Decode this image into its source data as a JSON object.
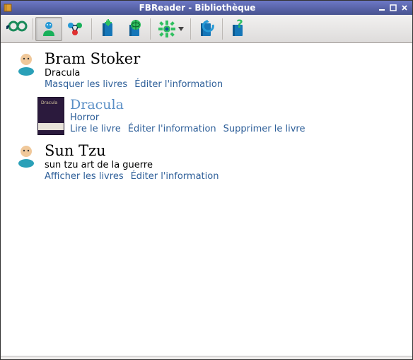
{
  "window": {
    "title": "FBReader - Bibliothèque"
  },
  "toolbar": {
    "icons": [
      "search",
      "author",
      "network",
      "add-book",
      "net-library",
      "settings",
      "refresh",
      "help"
    ]
  },
  "authors": [
    {
      "name": "Bram Stoker",
      "subtitle": "Dracula",
      "actions": {
        "toggle": "Masquer les livres",
        "edit": "Éditer l'information"
      },
      "books": [
        {
          "title": "Dracula",
          "genre": "Horror",
          "actions": {
            "read": "Lire le livre",
            "edit": "Éditer l'information",
            "remove": "Supprimer le livre"
          }
        }
      ]
    },
    {
      "name": "Sun Tzu",
      "subtitle": "sun tzu art de la guerre",
      "actions": {
        "toggle": "Afficher les livres",
        "edit": "Éditer l'information"
      },
      "books": []
    }
  ]
}
